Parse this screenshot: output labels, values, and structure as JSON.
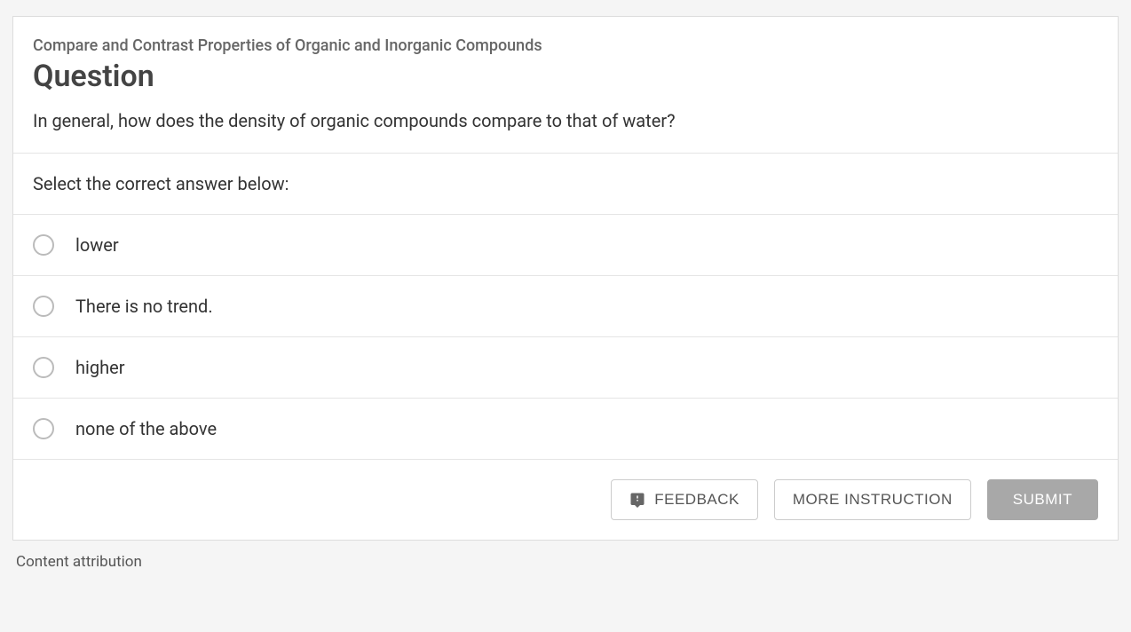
{
  "topic": "Compare and Contrast Properties of Organic and Inorganic Compounds",
  "title": "Question",
  "question_text": "In general, how does the density of organic compounds compare to that of water?",
  "instruction": "Select the correct answer below:",
  "options": [
    "lower",
    "There is no trend.",
    "higher",
    "none of the above"
  ],
  "buttons": {
    "feedback": "FEEDBACK",
    "more_instruction": "MORE INSTRUCTION",
    "submit": "SUBMIT"
  },
  "attribution": "Content attribution"
}
